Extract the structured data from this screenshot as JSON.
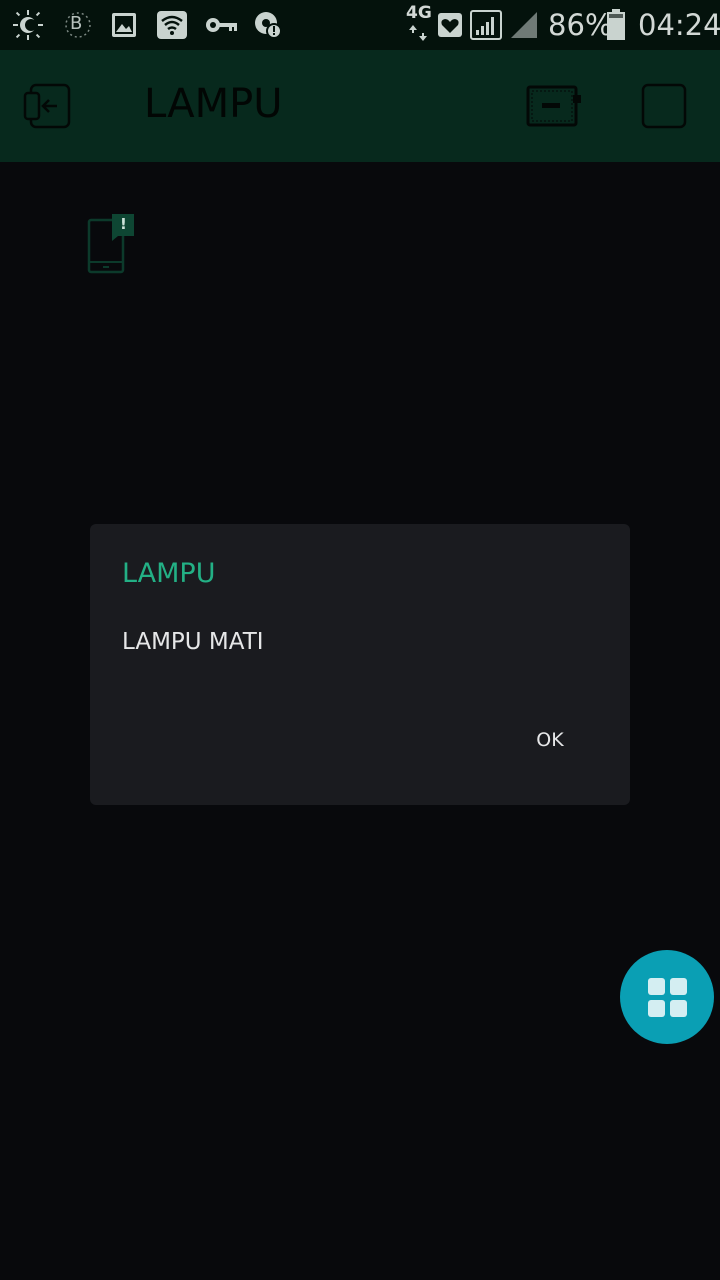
{
  "status_bar": {
    "icons": [
      "brightness-icon",
      "bluetooth-icon",
      "gallery-icon",
      "wifi-icon",
      "vpn-key-icon",
      "data-alert-icon",
      "heart-icon",
      "signal-icon",
      "signal-secondary-icon",
      "battery-icon"
    ],
    "network_type": "4G",
    "battery_percent": "86%",
    "time": "04:24",
    "bluetooth_letter": "B"
  },
  "toolbar": {
    "title": "LAMPU",
    "icons": [
      "exit-icon",
      "device-icon",
      "stop-icon"
    ]
  },
  "widget": {
    "icon": "phone-notification-icon",
    "badge": "!"
  },
  "dialog": {
    "title": "LAMPU",
    "message": "LAMPU MATI",
    "ok_label": "OK"
  },
  "fab": {
    "icon": "widget-grid-icon"
  },
  "colors": {
    "status_bar_bg": "#04120c",
    "toolbar_bg": "#07291d",
    "screen_bg": "#08090c",
    "dialog_bg": "#1a1b1f",
    "dialog_title": "#23b085",
    "fab_bg": "#0a9fb4"
  }
}
